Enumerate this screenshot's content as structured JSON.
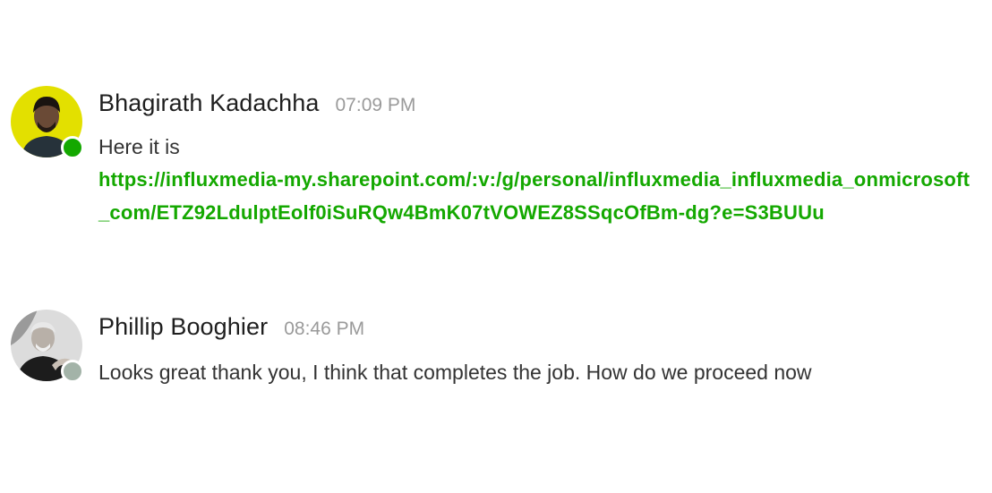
{
  "messages": [
    {
      "sender": "Bhagirath Kadachha",
      "time": "07:09 PM",
      "text": "Here it is",
      "link": "https://influxmedia-my.sharepoint.com/:v:/g/personal/influxmedia_influxmedia_onmicrosoft_com/ETZ92LdulptEolf0iSuRQw4BmK07tVOWEZ8SSqcOfBm-dg?e=S3BUUu",
      "presence": "online",
      "presence_color": "#14a800",
      "avatar_bg": "#e6e600"
    },
    {
      "sender": "Phillip Booghier",
      "time": "08:46 PM",
      "text": "Looks great thank you, I think that completes the job. How do we proceed now",
      "presence": "offline",
      "presence_color": "#a3b3a8",
      "avatar_bg": "#d9d9d9"
    }
  ],
  "colors": {
    "link": "#14a800",
    "timestamp": "#9a9a9a",
    "sender": "#1f1f1f"
  }
}
